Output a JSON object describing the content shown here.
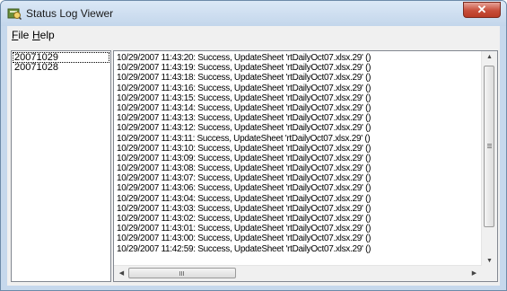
{
  "window": {
    "title": "Status Log Viewer",
    "close_glyph": "✕",
    "icon": "log-viewer-app-icon"
  },
  "menu": [
    {
      "key": "F",
      "rest": "ile"
    },
    {
      "key": "H",
      "rest": "elp"
    }
  ],
  "dates": [
    {
      "label": "20071029",
      "selected": true
    },
    {
      "label": "20071028",
      "selected": false
    }
  ],
  "log_lines": [
    "10/29/2007 11:43:20: Success, UpdateSheet 'rtDailyOct07.xlsx.29' ()",
    "10/29/2007 11:43:19: Success, UpdateSheet 'rtDailyOct07.xlsx.29' ()",
    "10/29/2007 11:43:18: Success, UpdateSheet 'rtDailyOct07.xlsx.29' ()",
    "10/29/2007 11:43:16: Success, UpdateSheet 'rtDailyOct07.xlsx.29' ()",
    "10/29/2007 11:43:15: Success, UpdateSheet 'rtDailyOct07.xlsx.29' ()",
    "10/29/2007 11:43:14: Success, UpdateSheet 'rtDailyOct07.xlsx.29' ()",
    "10/29/2007 11:43:13: Success, UpdateSheet 'rtDailyOct07.xlsx.29' ()",
    "10/29/2007 11:43:12: Success, UpdateSheet 'rtDailyOct07.xlsx.29' ()",
    "10/29/2007 11:43:11: Success, UpdateSheet 'rtDailyOct07.xlsx.29' ()",
    "10/29/2007 11:43:10: Success, UpdateSheet 'rtDailyOct07.xlsx.29' ()",
    "10/29/2007 11:43:09: Success, UpdateSheet 'rtDailyOct07.xlsx.29' ()",
    "10/29/2007 11:43:08: Success, UpdateSheet 'rtDailyOct07.xlsx.29' ()",
    "10/29/2007 11:43:07: Success, UpdateSheet 'rtDailyOct07.xlsx.29' ()",
    "10/29/2007 11:43:06: Success, UpdateSheet 'rtDailyOct07.xlsx.29' ()",
    "10/29/2007 11:43:04: Success, UpdateSheet 'rtDailyOct07.xlsx.29' ()",
    "10/29/2007 11:43:03: Success, UpdateSheet 'rtDailyOct07.xlsx.29' ()",
    "10/29/2007 11:43:02: Success, UpdateSheet 'rtDailyOct07.xlsx.29' ()",
    "10/29/2007 11:43:01: Success, UpdateSheet 'rtDailyOct07.xlsx.29' ()",
    "10/29/2007 11:43:00: Success, UpdateSheet 'rtDailyOct07.xlsx.29' ()",
    "10/29/2007 11:42:59: Success, UpdateSheet 'rtDailyOct07.xlsx.29' ()"
  ],
  "scrollbars": {
    "up": "▲",
    "down": "▼",
    "left": "◀",
    "right": "▶"
  },
  "colors": {
    "close_button": "#c74e3a",
    "title_bar": "#c6d8ec"
  }
}
